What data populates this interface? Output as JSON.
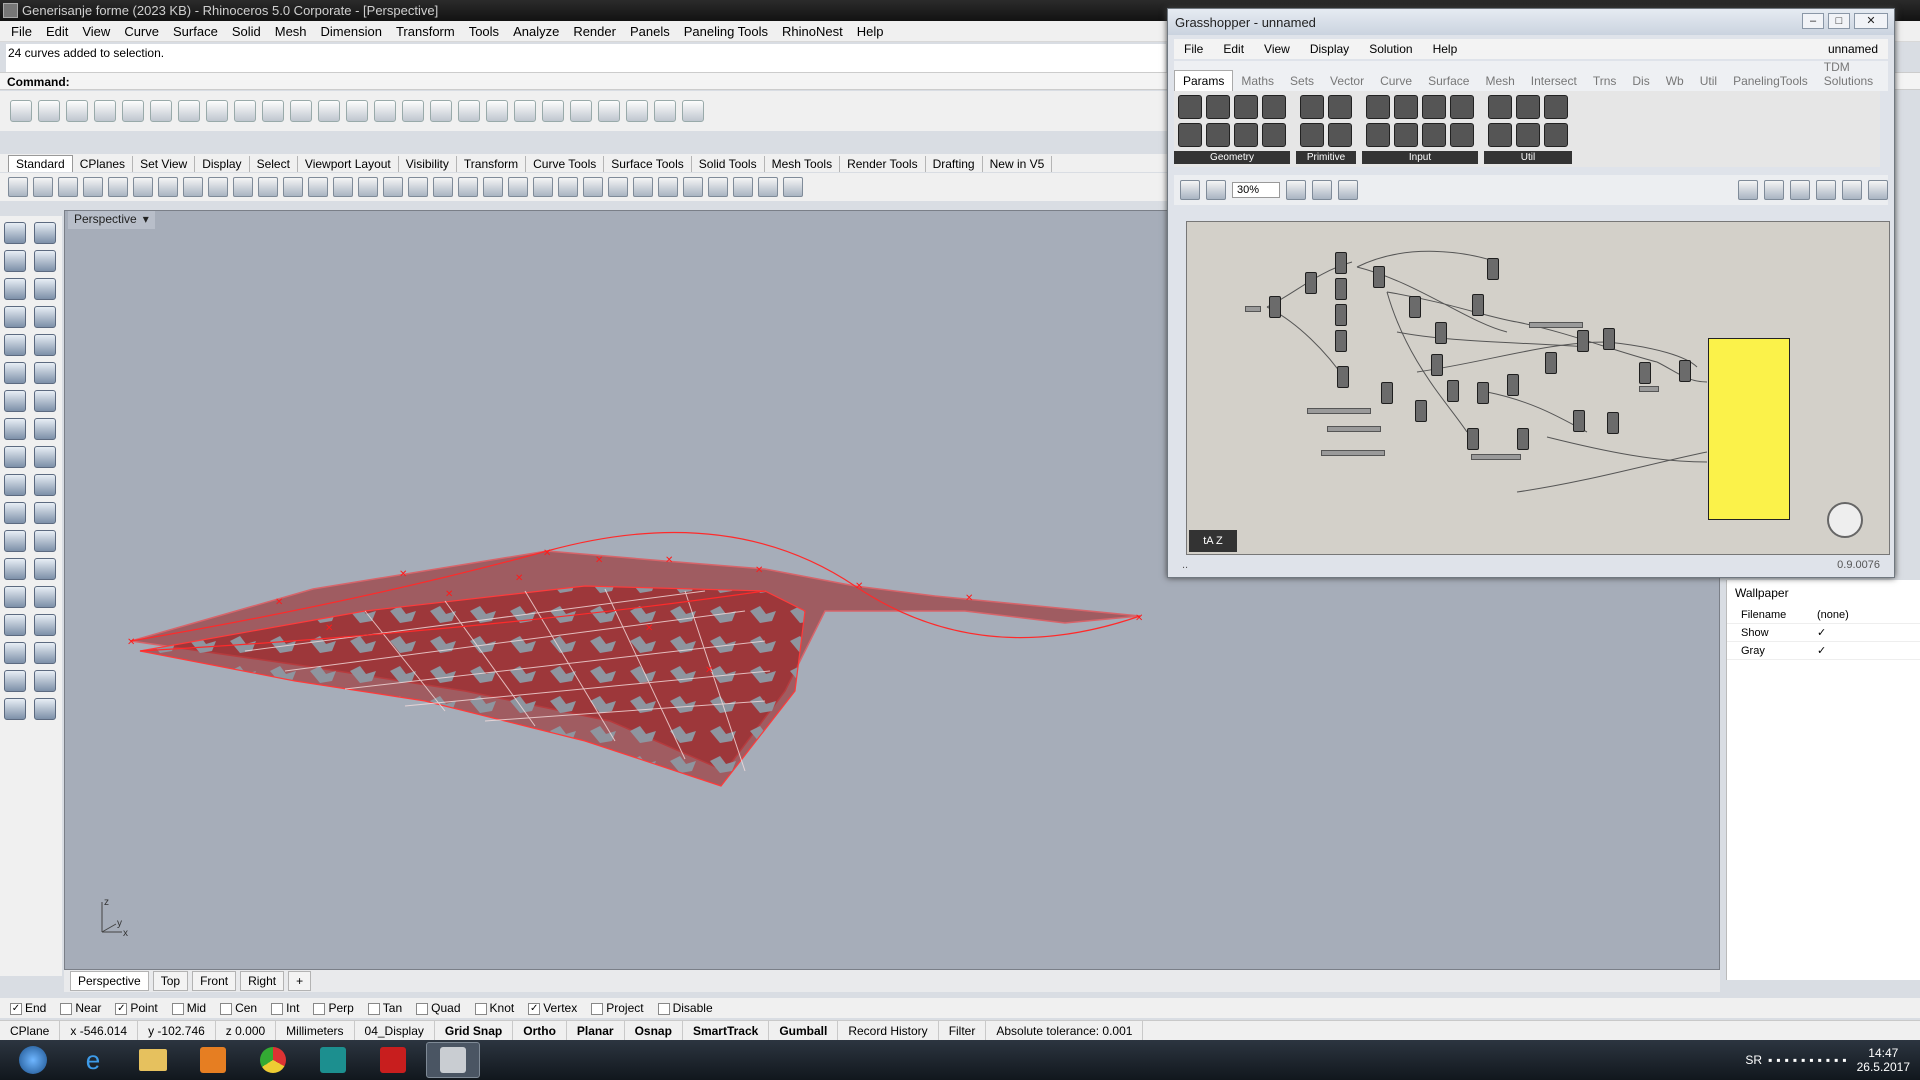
{
  "window": {
    "title": "Generisanje forme (2023 KB) - Rhinoceros  5.0 Corporate - [Perspective]"
  },
  "menu": [
    "File",
    "Edit",
    "View",
    "Curve",
    "Surface",
    "Solid",
    "Mesh",
    "Dimension",
    "Transform",
    "Tools",
    "Analyze",
    "Render",
    "Panels",
    "Paneling Tools",
    "RhinoNest",
    "Help"
  ],
  "history": {
    "text": "24 curves added to selection."
  },
  "command": {
    "label": "Command:"
  },
  "toolbar_tabs": [
    "Standard",
    "CPlanes",
    "Set View",
    "Display",
    "Select",
    "Viewport Layout",
    "Visibility",
    "Transform",
    "Curve Tools",
    "Surface Tools",
    "Solid Tools",
    "Mesh Tools",
    "Render Tools",
    "Drafting",
    "New in V5"
  ],
  "viewport": {
    "name": "Perspective",
    "axis_z": "z",
    "axis_x": "x",
    "axis_y": "y"
  },
  "viewport_tabs": [
    "Perspective",
    "Top",
    "Front",
    "Right"
  ],
  "osnap": [
    {
      "label": "End",
      "checked": true
    },
    {
      "label": "Near",
      "checked": false
    },
    {
      "label": "Point",
      "checked": true
    },
    {
      "label": "Mid",
      "checked": false
    },
    {
      "label": "Cen",
      "checked": false
    },
    {
      "label": "Int",
      "checked": false
    },
    {
      "label": "Perp",
      "checked": false
    },
    {
      "label": "Tan",
      "checked": false
    },
    {
      "label": "Quad",
      "checked": false
    },
    {
      "label": "Knot",
      "checked": false
    },
    {
      "label": "Vertex",
      "checked": true
    },
    {
      "label": "Project",
      "checked": false
    },
    {
      "label": "Disable",
      "checked": false
    }
  ],
  "status": {
    "cplane": "CPlane",
    "x": "x -546.014",
    "y": "y -102.746",
    "z": "z 0.000",
    "units": "Millimeters",
    "layer": "04_Display",
    "toggles": [
      "Grid Snap",
      "Ortho",
      "Planar",
      "Osnap",
      "SmartTrack",
      "Gumball",
      "Record History",
      "Filter"
    ],
    "tolerance": "Absolute tolerance: 0.001"
  },
  "properties": {
    "section": "Wallpaper",
    "rows": [
      {
        "key": "Filename",
        "value": "(none)"
      },
      {
        "key": "Show",
        "value": "✓"
      },
      {
        "key": "Gray",
        "value": "✓"
      }
    ]
  },
  "grasshopper": {
    "title": "Grasshopper - unnamed",
    "doc_name": "unnamed",
    "menu": [
      "File",
      "Edit",
      "View",
      "Display",
      "Solution",
      "Help"
    ],
    "tabs": [
      "Params",
      "Maths",
      "Sets",
      "Vector",
      "Curve",
      "Surface",
      "Mesh",
      "Intersect",
      "Trns",
      "Dis",
      "Wb",
      "Util",
      "PanelingTools",
      "TDM Solutions"
    ],
    "groups": [
      "Geometry",
      "Primitive",
      "Input",
      "Util"
    ],
    "zoom": "30%",
    "version": "0.9.0076"
  },
  "taskbar": {
    "lang": "SR",
    "time": "14:47",
    "date": "26.5.2017"
  },
  "colors": {
    "surface": "#9b1a1a",
    "highlight": "#ff2a2a",
    "panel_yellow": "#fbf24a"
  }
}
